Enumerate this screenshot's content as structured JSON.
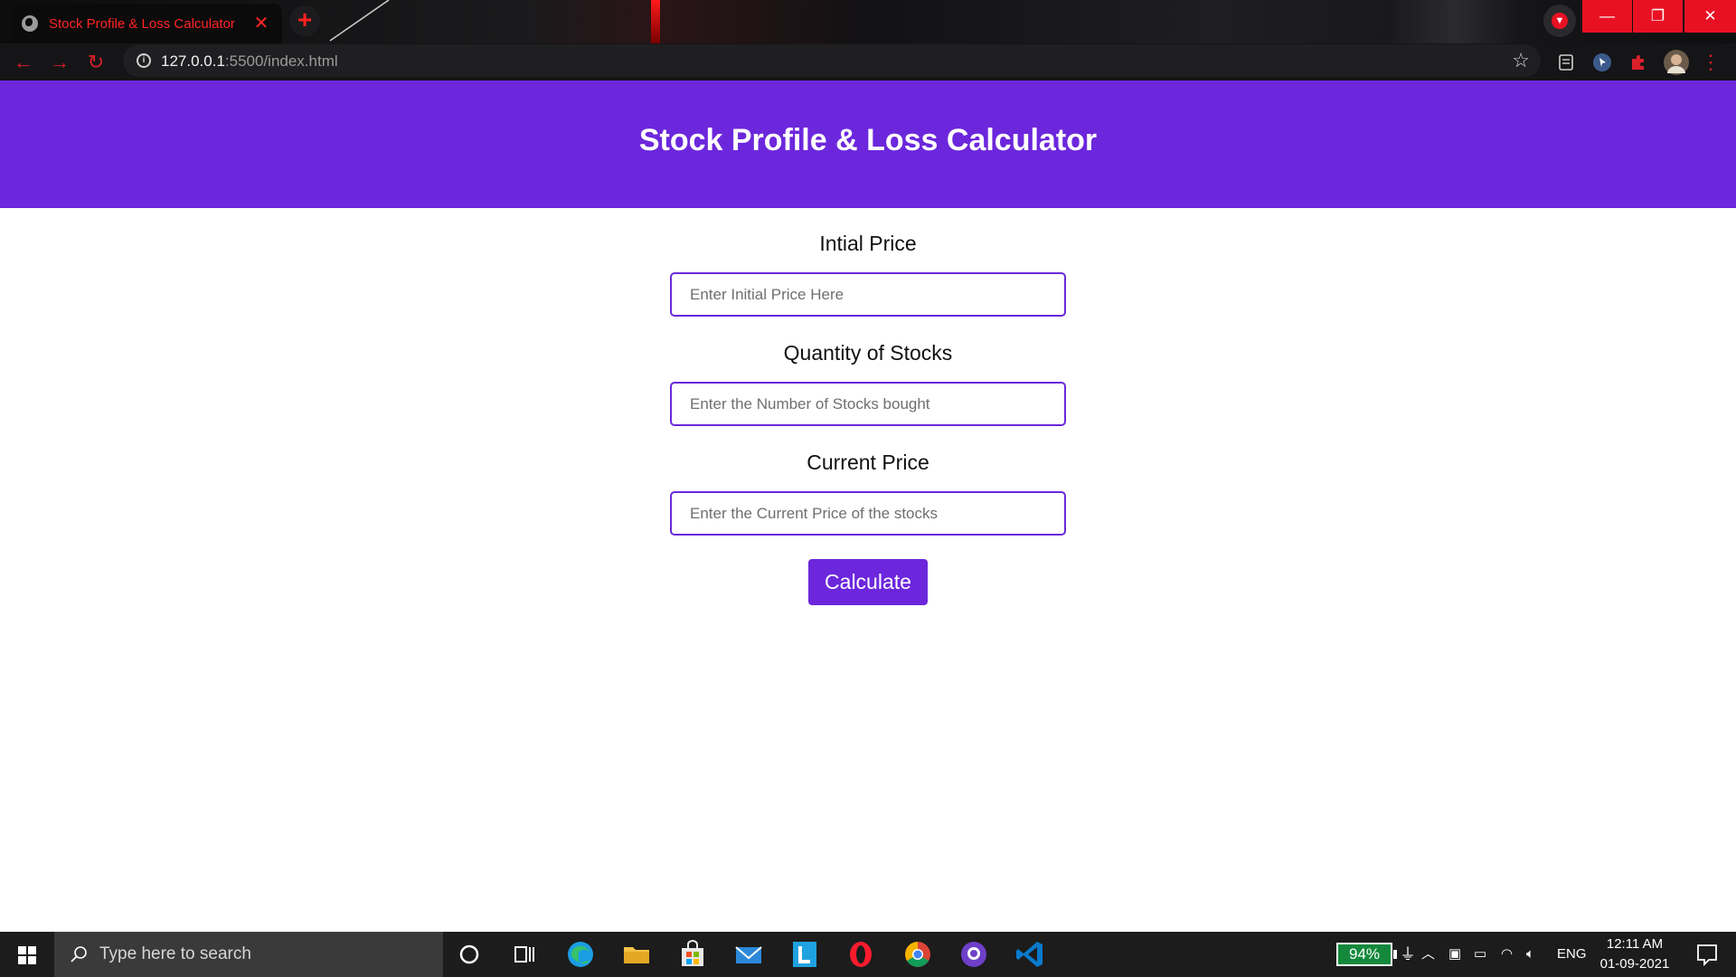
{
  "browser": {
    "tab_title": "Stock Profile & Loss Calculator",
    "tab_close": "✕",
    "new_tab": "+",
    "url_host": "127.0.0.1",
    "url_rest": ":5500/index.html",
    "window_controls": {
      "minimize": "—",
      "restore": "❐",
      "close": "✕"
    }
  },
  "page": {
    "title": "Stock Profile & Loss Calculator",
    "fields": [
      {
        "label": "Intial Price",
        "placeholder": "Enter Initial Price Here",
        "value": ""
      },
      {
        "label": "Quantity of Stocks",
        "placeholder": "Enter the Number of Stocks bought",
        "value": ""
      },
      {
        "label": "Current Price",
        "placeholder": "Enter the Current Price of the stocks",
        "value": ""
      }
    ],
    "calculate_label": "Calculate"
  },
  "taskbar": {
    "search_placeholder": "Type here to search",
    "battery": "94%",
    "language": "ENG",
    "time": "12:11 AM",
    "date": "01-09-2021",
    "apps": [
      "cortana-icon",
      "task-view-icon",
      "edge-icon",
      "file-explorer-icon",
      "store-icon",
      "mail-icon",
      "l-app-icon",
      "opera-icon",
      "chrome-icon",
      "github-desktop-icon",
      "vscode-icon"
    ]
  },
  "colors": {
    "accent": "#6c27dc",
    "tab_text": "#ff2424",
    "window_close": "#e81123",
    "battery": "#14893c"
  }
}
